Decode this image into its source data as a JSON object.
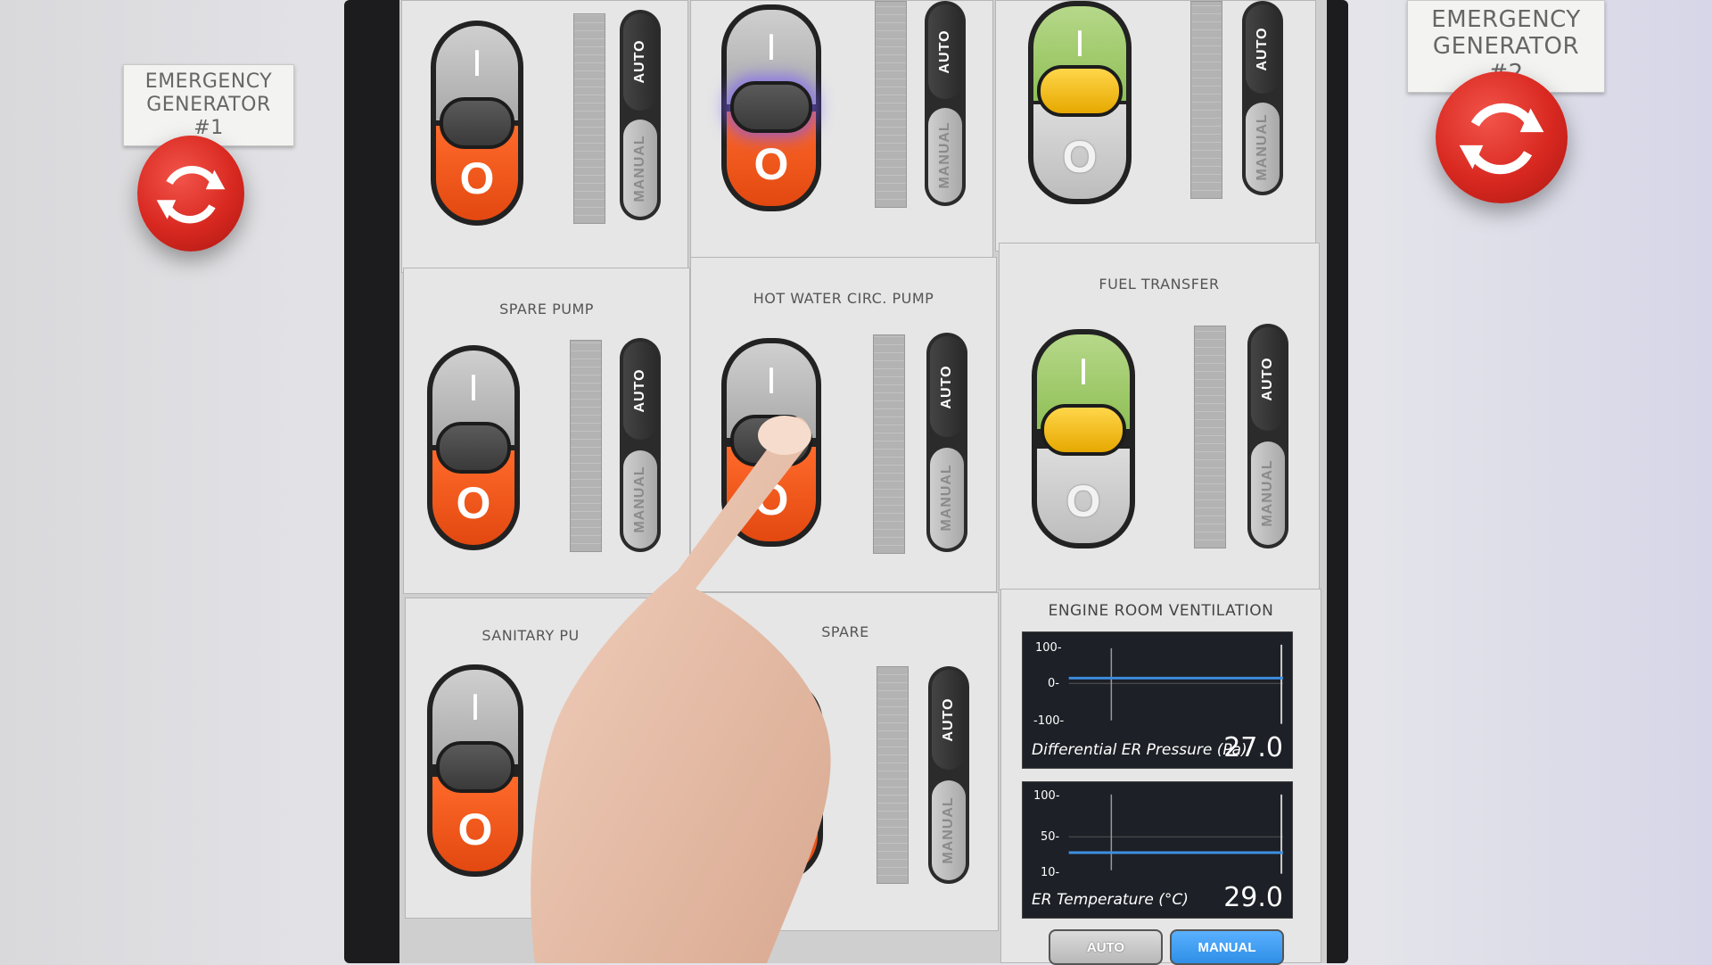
{
  "wall": {
    "generator_1_label": "EMERGENCY\nGENERATOR #1",
    "generator_2_label": "EMERGENCY\nGENERATOR #2"
  },
  "toggle_labels": {
    "on": "I",
    "off": "O"
  },
  "selector_labels": {
    "auto": "AUTO",
    "manual": "MANUAL"
  },
  "panels": [
    {
      "title": "",
      "state": "off"
    },
    {
      "title": "",
      "state": "off"
    },
    {
      "title": "",
      "state": "on"
    },
    {
      "title": "SPARE PUMP",
      "state": "off"
    },
    {
      "title": "HOT WATER CIRC.  PUMP",
      "state": "off"
    },
    {
      "title": "FUEL TRANSFER",
      "state": "on"
    },
    {
      "title": "SANITARY PU",
      "state": "off"
    },
    {
      "title": "SPARE",
      "state": "off"
    }
  ],
  "ventilation": {
    "title": "ENGINE ROOM VENTILATION",
    "pressure": {
      "label": "Differential ER Pressure (Pa)",
      "value": "27.0",
      "ticks": [
        "100-",
        "0-",
        "-100-"
      ]
    },
    "temperature": {
      "label": "ER Temperature (°C)",
      "value": "29.0",
      "ticks": [
        "100-",
        "50-",
        "10-"
      ]
    },
    "mode_buttons": [
      "AUTO",
      "MANUAL"
    ],
    "selected_mode": "MANUAL"
  },
  "colors": {
    "off_orange": "#e24810",
    "on_green": "#8fbf55",
    "knob_yellow": "#e6a800",
    "estop_red": "#d82820",
    "manual_blue": "#2f8fe6"
  }
}
